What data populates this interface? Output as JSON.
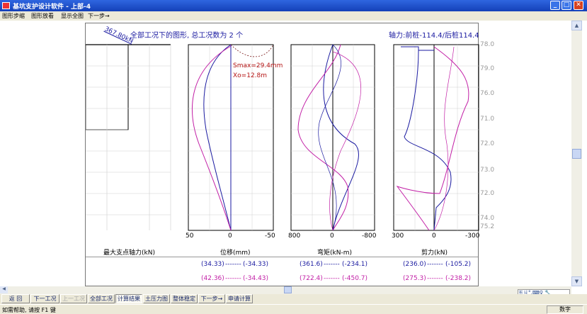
{
  "window": {
    "title": "基坑支护设计软件 - 上部-4",
    "minimize": "_",
    "maximize": "□",
    "close": "✕"
  },
  "menu": [
    "图形步缩",
    "图形放看",
    "显示全图",
    "下一步→"
  ],
  "figure": {
    "heading": "全部工况下的图形, 总工况数为 2 个",
    "axial_force": "轴力:前桩-114.4/后桩114.4",
    "support_label": "367.80kN",
    "support_max_label": "最大支点轴力(kN)",
    "disp_note1": "Smax=29.4mm",
    "disp_note2": "Xo=12.8m",
    "depth_ticks": [
      "78.0",
      "79.0",
      "76.0",
      "71.0",
      "72.0",
      "73.0",
      "72.0",
      "74.0",
      "75.2"
    ],
    "panels": [
      {
        "name": "位移(mm)",
        "ticks": [
          "50",
          "0",
          "-50"
        ]
      },
      {
        "name": "弯矩(kN-m)",
        "ticks": [
          "800",
          "0",
          "-800"
        ]
      },
      {
        "name": "剪力(kN)",
        "ticks": [
          "300",
          "0",
          "-300"
        ]
      }
    ],
    "ranges_row1": [
      {
        "a": "(34.33)",
        "b": "(-34.33)"
      },
      {
        "a": "(361.6)",
        "b": "(-234.1)"
      },
      {
        "a": "(236.0)",
        "b": "(-105.2)"
      }
    ],
    "ranges_row2": [
      {
        "a": "(42.36)",
        "b": "(-34.43)"
      },
      {
        "a": "(722.4)",
        "b": "(-450.7)"
      },
      {
        "a": "(275.3)",
        "b": "(-238.2)"
      }
    ],
    "dashes": "-------",
    "colors": {
      "case1": "#1a1aa0",
      "case2": "#c21fa6",
      "grid": "#b5b5b5",
      "envelope": "#7a1a1a"
    }
  },
  "toolbar": [
    "返 回",
    "下一工况",
    "上一工况",
    "全部工况",
    "计算结果",
    "土压力图",
    "整体稳定",
    "下一步→",
    "申请计算"
  ],
  "status": {
    "message": "如需帮助, 请按 F1 键",
    "mode": "数字"
  },
  "ime": "五ㄐ°,⌨♀ 🔧"
}
